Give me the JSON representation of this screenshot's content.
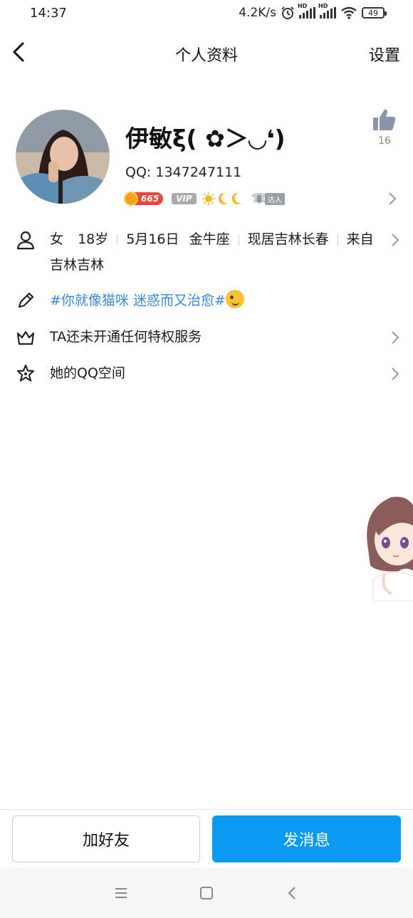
{
  "status_bar": {
    "time": "14:37",
    "speed": "4.2K/s",
    "hd_label": "HD",
    "battery": "49"
  },
  "nav": {
    "title": "个人资料",
    "settings_label": "设置"
  },
  "profile": {
    "nickname": "伊敏ξ( ✿＞◡❛)",
    "qq_label": "QQ:",
    "qq_number": "1347247111",
    "level_badge": "665",
    "vip_badge": "VIP",
    "talent_badge": "达人",
    "like_count": "16"
  },
  "info": {
    "gender": "女",
    "age": "18岁",
    "birthday": "5月16日",
    "zodiac": "金牛座",
    "residence": "现居吉林长春",
    "hometown_line1": "来自",
    "hometown_line2": "吉林吉林"
  },
  "signature": {
    "text": "#你就像猫咪 迷惑而又治愈#"
  },
  "privilege": {
    "label": "TA还未开通任何特权服务"
  },
  "qzone": {
    "label": "她的QQ空间"
  },
  "actions": {
    "add_friend": "加好友",
    "send_message": "发消息"
  },
  "colors": {
    "accent": "#0a9af4",
    "link": "#3b86d6",
    "level_badge": "#e8483a"
  }
}
